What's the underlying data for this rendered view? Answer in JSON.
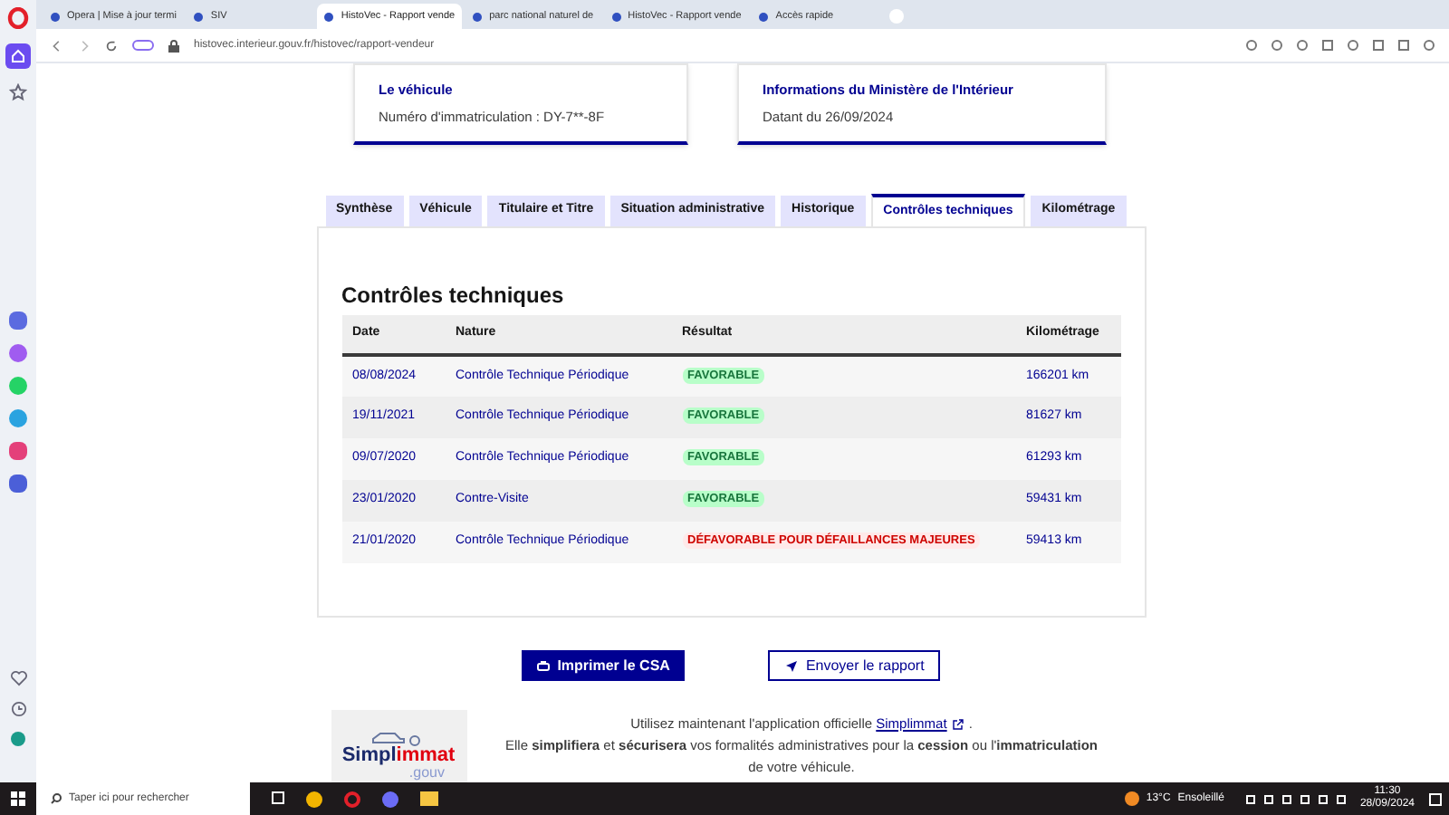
{
  "browser": {
    "tabs": [
      {
        "title": "Opera | Mise à jour termi",
        "selected": false
      },
      {
        "title": "SIV",
        "selected": false
      },
      {
        "title": "HistoVec - Rapport vende",
        "selected": true
      },
      {
        "title": "parc national naturel de",
        "selected": false
      },
      {
        "title": "HistoVec - Rapport vende",
        "selected": false
      },
      {
        "title": "Accès rapide",
        "selected": false
      }
    ],
    "url": "histovec.interieur.gouv.fr/histovec/rapport-vendeur"
  },
  "cards": [
    {
      "title": "Le véhicule",
      "text": "Numéro d'immatriculation : DY-7**-8F"
    },
    {
      "title": "Informations du Ministère de l'Intérieur",
      "text": "Datant du 26/09/2024"
    }
  ],
  "tabs": [
    {
      "label": "Synthèse",
      "selected": false
    },
    {
      "label": "Véhicule",
      "selected": false
    },
    {
      "label": "Titulaire et Titre",
      "selected": false
    },
    {
      "label": "Situation administrative",
      "selected": false
    },
    {
      "label": "Historique",
      "selected": false
    },
    {
      "label": "Contrôles techniques",
      "selected": true
    },
    {
      "label": "Kilométrage",
      "selected": false
    }
  ],
  "section_title": "Contrôles techniques",
  "table": {
    "columns": [
      "Date",
      "Nature",
      "Résultat",
      "Kilométrage"
    ],
    "rows": [
      {
        "date": "08/08/2024",
        "nature": "Contrôle Technique Périodique",
        "result": "FAVORABLE",
        "kind": "favorable",
        "km": "166201 km"
      },
      {
        "date": "19/11/2021",
        "nature": "Contrôle Technique Périodique",
        "result": "FAVORABLE",
        "kind": "favorable",
        "km": "81627 km"
      },
      {
        "date": "09/07/2020",
        "nature": "Contrôle Technique Périodique",
        "result": "FAVORABLE",
        "kind": "favorable",
        "km": "61293 km"
      },
      {
        "date": "23/01/2020",
        "nature": "Contre-Visite",
        "result": "FAVORABLE",
        "kind": "favorable",
        "km": "59431 km"
      },
      {
        "date": "21/01/2020",
        "nature": "Contrôle Technique Périodique",
        "result": "DÉFAVORABLE POUR DÉFAILLANCES MAJEURES",
        "kind": "defavorable",
        "km": "59413 km"
      }
    ]
  },
  "buttons": {
    "print": "Imprimer le CSA",
    "send": "Envoyer le rapport"
  },
  "footer": {
    "logo_top": "Simpl",
    "logo_accent": "immat",
    "logo_sub": ".gouv",
    "line1": "Utilisez maintenant l'application officielle",
    "link": "Simplimmat",
    "link_end": ".",
    "line2": "Elle **simplifiera** et **sécurisera** vos formalités administratives pour la **cession** ou l'**immatriculation** de votre véhicule."
  },
  "taskbar": {
    "search_placeholder": "Taper ici pour rechercher",
    "temperature": "13°C",
    "weather": "Ensoleillé",
    "time": "11:30",
    "date": "28/09/2024"
  }
}
